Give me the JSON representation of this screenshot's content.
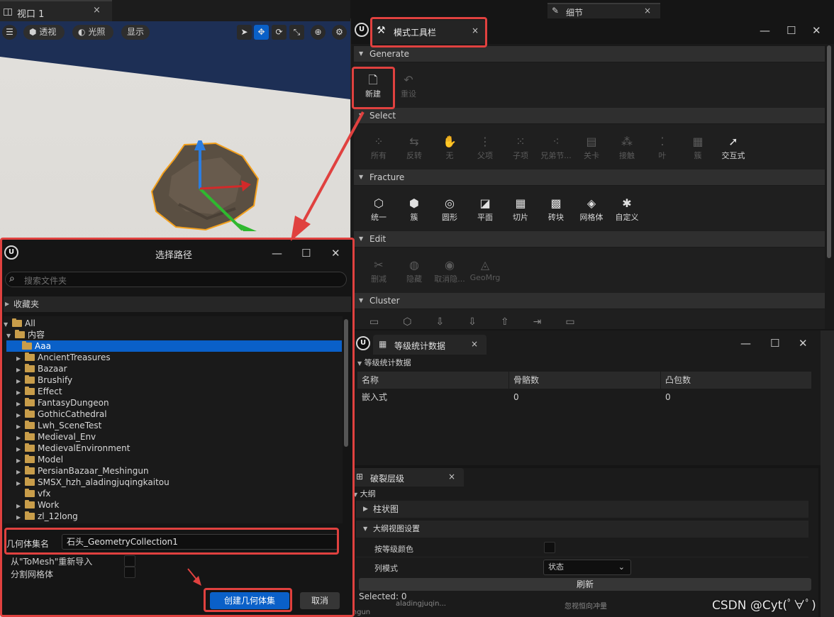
{
  "viewport": {
    "tab_label": "视口 1",
    "close": "×",
    "perspective_label": "透视",
    "lit_label": "光照",
    "show_label": "显示"
  },
  "details_tab": {
    "label": "细节",
    "close": "×"
  },
  "mode_toolbar": {
    "tab_label": "模式工具栏",
    "close": "×",
    "sections": [
      {
        "name": "Generate",
        "tools": [
          {
            "label": "新建",
            "icon": "new-icon",
            "enabled": true
          },
          {
            "label": "重设",
            "icon": "reset-icon",
            "enabled": false
          }
        ]
      },
      {
        "name": "Select",
        "tools": [
          {
            "label": "所有",
            "icon": "select-all-icon",
            "enabled": false
          },
          {
            "label": "反转",
            "icon": "invert-icon",
            "enabled": false
          },
          {
            "label": "无",
            "icon": "none-icon",
            "enabled": false
          },
          {
            "label": "父项",
            "icon": "parent-icon",
            "enabled": false
          },
          {
            "label": "子项",
            "icon": "children-icon",
            "enabled": false
          },
          {
            "label": "兄弟节...",
            "icon": "siblings-icon",
            "enabled": false
          },
          {
            "label": "关卡",
            "icon": "level-icon",
            "enabled": false
          },
          {
            "label": "接触",
            "icon": "contact-icon",
            "enabled": false
          },
          {
            "label": "叶",
            "icon": "leaf-icon",
            "enabled": false
          },
          {
            "label": "簇",
            "icon": "cluster-icon",
            "enabled": false
          },
          {
            "label": "交互式",
            "icon": "interactive-icon",
            "enabled": true
          }
        ]
      },
      {
        "name": "Fracture",
        "tools": [
          {
            "label": "统一",
            "icon": "uniform-icon",
            "enabled": true
          },
          {
            "label": "簇",
            "icon": "cluster-fracture-icon",
            "enabled": true
          },
          {
            "label": "圆形",
            "icon": "radial-icon",
            "enabled": true
          },
          {
            "label": "平面",
            "icon": "planar-icon",
            "enabled": true
          },
          {
            "label": "切片",
            "icon": "slice-icon",
            "enabled": true
          },
          {
            "label": "砖块",
            "icon": "brick-icon",
            "enabled": true
          },
          {
            "label": "网格体",
            "icon": "mesh-icon",
            "enabled": true
          },
          {
            "label": "自定义",
            "icon": "custom-icon",
            "enabled": true
          }
        ]
      },
      {
        "name": "Edit",
        "tools": [
          {
            "label": "删减",
            "icon": "prune-icon",
            "enabled": false
          },
          {
            "label": "隐藏",
            "icon": "hide-icon",
            "enabled": false
          },
          {
            "label": "取消隐...",
            "icon": "unhide-icon",
            "enabled": false
          },
          {
            "label": "GeoMrg",
            "icon": "geomerge-icon",
            "enabled": false
          }
        ]
      },
      {
        "name": "Cluster",
        "tools": []
      }
    ]
  },
  "level_stats": {
    "tab_label": "等级统计数据",
    "close": "×",
    "section_label": "等级统计数据",
    "columns": [
      "名称",
      "骨骼数",
      "凸包数"
    ],
    "rows": [
      [
        "嵌入式",
        "0",
        "0"
      ]
    ]
  },
  "fracture_hierarchy": {
    "tab_label": "破裂层级",
    "close": "×",
    "outline_label": "大纲",
    "histogram_label": "柱状图",
    "outline_settings_label": "大纲视图设置",
    "color_by_level_label": "按等级颜色",
    "column_mode_label": "列模式",
    "column_mode_value": "状态",
    "refresh_label": "刷新",
    "selected_label": "Selected: 0",
    "bottom_left_text": "aladingjuqin...",
    "bottom_left_text2": "ingun",
    "bottom_right_text": "忽视恒向冲量"
  },
  "choose_path_dialog": {
    "title": "选择路径",
    "search_placeholder": "搜索文件夹",
    "favorites_label": "收藏夹",
    "tree": [
      {
        "label": "All",
        "level": 0,
        "expanded": true
      },
      {
        "label": "内容",
        "level": 1,
        "expanded": true
      },
      {
        "label": "Aaa",
        "level": 2,
        "selected": true,
        "has_children": false
      },
      {
        "label": "AncientTreasures",
        "level": 2,
        "has_children": true
      },
      {
        "label": "Bazaar",
        "level": 2,
        "has_children": true
      },
      {
        "label": "Brushify",
        "level": 2,
        "has_children": true
      },
      {
        "label": "Effect",
        "level": 2,
        "has_children": true
      },
      {
        "label": "FantasyDungeon",
        "level": 2,
        "has_children": true
      },
      {
        "label": "GothicCathedral",
        "level": 2,
        "has_children": true
      },
      {
        "label": "Lwh_SceneTest",
        "level": 2,
        "has_children": true
      },
      {
        "label": "Medieval_Env",
        "level": 2,
        "has_children": true
      },
      {
        "label": "MedievalEnvironment",
        "level": 2,
        "has_children": true
      },
      {
        "label": "Model",
        "level": 2,
        "has_children": true
      },
      {
        "label": "PersianBazaar_Meshingun",
        "level": 2,
        "has_children": true
      },
      {
        "label": "SMSX_hzh_aladingjuqingkaitou",
        "level": 2,
        "has_children": true
      },
      {
        "label": "vfx",
        "level": 2,
        "has_children": false
      },
      {
        "label": "Work",
        "level": 2,
        "has_children": true
      },
      {
        "label": "zl_12long",
        "level": 2,
        "has_children": true
      }
    ],
    "collection_name_label": "几何体集名",
    "collection_name_value": "石头_GeometryCollection1",
    "reimport_label": "从\"ToMesh\"重新导入",
    "split_meshes_label": "分割网格体",
    "create_button": "创建几何体集",
    "cancel_button": "取消"
  },
  "watermark": "CSDN @Cyt(ﾟ∀ﾟ)",
  "colors": {
    "accent_blue": "#0a60c8",
    "highlight_red": "#e0413f",
    "folder": "#c89d4a"
  }
}
